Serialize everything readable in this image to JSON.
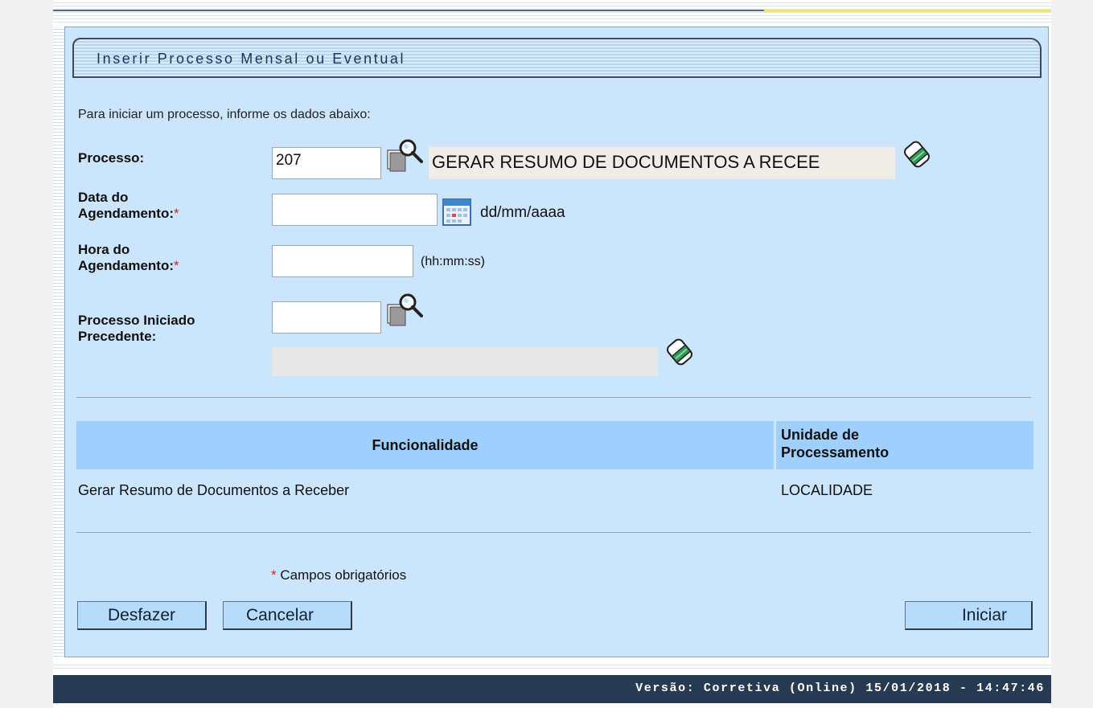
{
  "form": {
    "title": "Inserir Processo Mensal ou Eventual",
    "intro": "Para iniciar um processo, informe os dados abaixo:",
    "processo": {
      "label": "Processo:",
      "code_value": "207",
      "description_value": "GERAR RESUMO DE DOCUMENTOS A RECEE"
    },
    "data_agendamento": {
      "label_line1": "Data do",
      "label_line2": "Agendamento:",
      "required_mark": "*",
      "value": "",
      "format_hint": "dd/mm/aaaa"
    },
    "hora_agendamento": {
      "label_line1": "Hora do",
      "label_line2": "Agendamento:",
      "required_mark": "*",
      "value": "",
      "format_hint": "(hh:mm:ss)"
    },
    "processo_precedente": {
      "label_line1": "Processo Iniciado",
      "label_line2": "Precedente:",
      "code_value": "",
      "description_value": ""
    }
  },
  "grid": {
    "headers": {
      "funcionalidade": "Funcionalidade",
      "unidade_line1": "Unidade de",
      "unidade_line2": "Processamento"
    },
    "rows": [
      {
        "funcionalidade": "Gerar Resumo de Documentos a Receber",
        "unidade": "LOCALIDADE"
      }
    ]
  },
  "required_note": {
    "star": "*",
    "text": " Campos obrigatórios"
  },
  "buttons": {
    "desfazer": "Desfazer",
    "cancelar": "Cancelar",
    "iniciar": "Iniciar"
  },
  "footer": {
    "version_text": "Versão: Corretiva (Online) 15/01/2018 - 14:47:46"
  },
  "colors": {
    "panel_bg": "#cbe5fc",
    "grid_header_bg": "#9fd0fd",
    "button_bg": "#b7dcfb",
    "footer_bg": "#263a52",
    "required": "#e02020"
  },
  "icons": {
    "processo_search": "magnifier-search-icon",
    "processo_clear": "eraser-icon",
    "calendar": "calendar-icon",
    "precedente_search": "magnifier-search-icon",
    "precedente_clear": "eraser-icon"
  }
}
